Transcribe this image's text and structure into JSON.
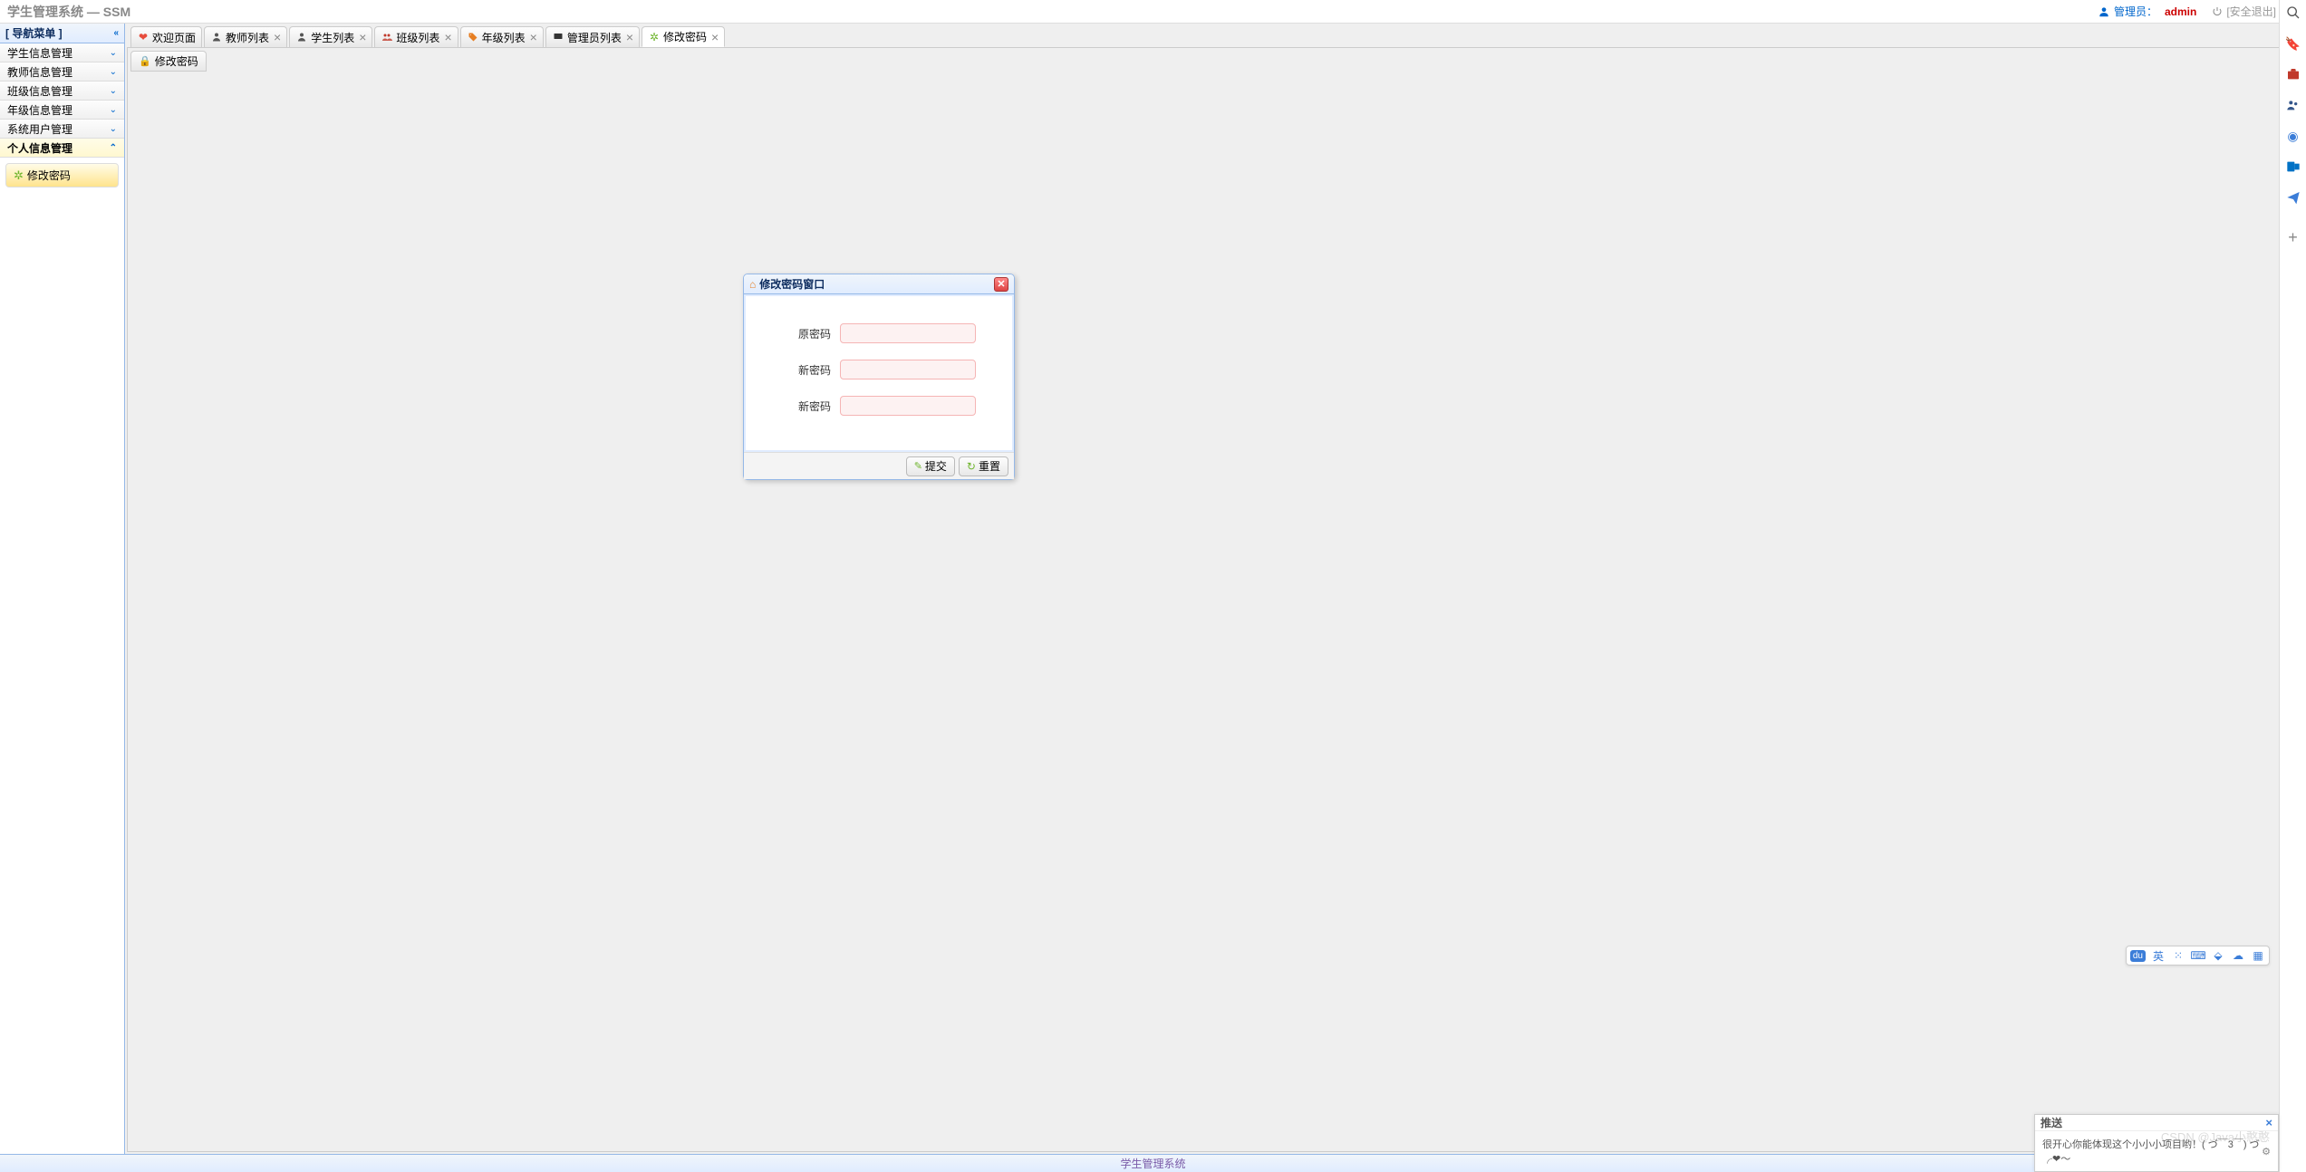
{
  "header": {
    "app_title": "学生管理系统 — SSM",
    "admin_label": "管理员：",
    "admin_name": "admin",
    "logout_text": "[安全退出]"
  },
  "sidebar": {
    "nav_title": "[ 导航菜单 ]",
    "items": [
      {
        "label": "学生信息管理"
      },
      {
        "label": "教师信息管理"
      },
      {
        "label": "班级信息管理"
      },
      {
        "label": "年级信息管理"
      },
      {
        "label": "系统用户管理"
      },
      {
        "label": "个人信息管理"
      }
    ],
    "sub_item": "修改密码"
  },
  "tabs": [
    {
      "label": "欢迎页面",
      "icon": "heart"
    },
    {
      "label": "教师列表",
      "icon": "person"
    },
    {
      "label": "学生列表",
      "icon": "person"
    },
    {
      "label": "班级列表",
      "icon": "group"
    },
    {
      "label": "年级列表",
      "icon": "tag"
    },
    {
      "label": "管理员列表",
      "icon": "monitor"
    },
    {
      "label": "修改密码",
      "icon": "gear"
    }
  ],
  "inner_panel": {
    "title": "修改密码"
  },
  "dialog": {
    "title": "修改密码窗口",
    "fields": [
      {
        "label": "原密码"
      },
      {
        "label": "新密码"
      },
      {
        "label": "新密码"
      }
    ],
    "submit": "提交",
    "reset": "重置"
  },
  "footer": {
    "text": "学生管理系统"
  },
  "ime": {
    "lang": "英"
  },
  "push": {
    "title": "推送",
    "message": "很开心你能体现这个小小小项目哟！( づ￣3￣) づ╭❤～"
  },
  "watermark": "CSDN @Java小憨憨"
}
